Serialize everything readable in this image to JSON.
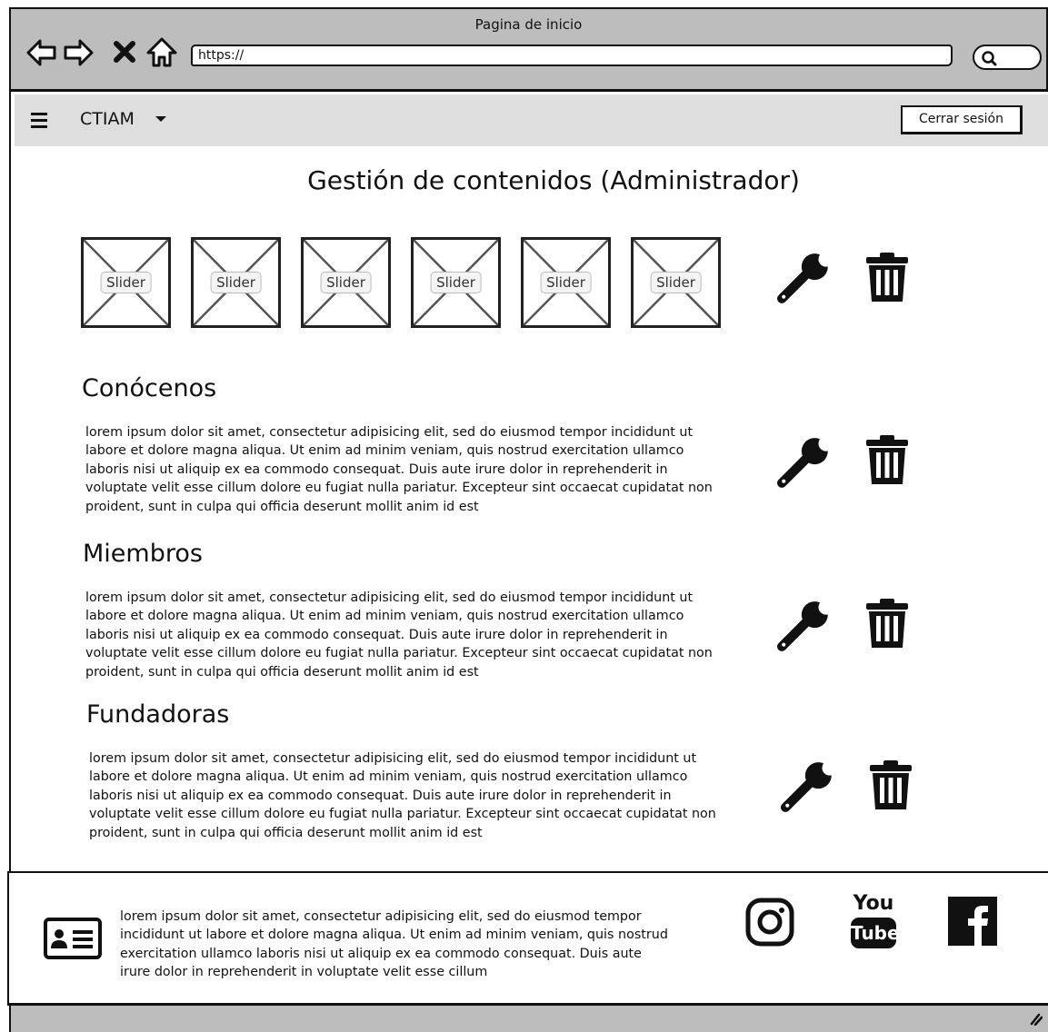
{
  "browser": {
    "window_title": "Pagina de inicio",
    "url": "https://",
    "icons": [
      "back-arrow-icon",
      "forward-arrow-icon",
      "stop-icon",
      "home-icon",
      "search-icon"
    ]
  },
  "navbar": {
    "brand": "CTIAM",
    "logout_label": "Cerrar sesión",
    "icons": [
      "hamburger-menu-icon",
      "caret-down-icon"
    ]
  },
  "page": {
    "title": "Gestión de contenidos (Administrador)"
  },
  "sliders": [
    {
      "label": "Slider"
    },
    {
      "label": "Slider"
    },
    {
      "label": "Slider"
    },
    {
      "label": "Slider"
    },
    {
      "label": "Slider"
    },
    {
      "label": "Slider"
    }
  ],
  "sections": [
    {
      "title": "Conócenos",
      "text": "lorem ipsum dolor sit amet, consectetur adipisicing elit, sed do eiusmod tempor incididunt ut labore et dolore magna aliqua. Ut enim ad minim veniam, quis nostrud exercitation ullamco laboris nisi ut aliquip ex ea commodo consequat. Duis aute irure dolor in reprehenderit in voluptate velit esse cillum dolore eu fugiat nulla pariatur. Excepteur sint occaecat cupidatat non proident, sunt in culpa qui officia deserunt mollit anim id est"
    },
    {
      "title": "Miembros",
      "text": "lorem ipsum dolor sit amet, consectetur adipisicing elit, sed do eiusmod tempor incididunt ut labore et dolore magna aliqua. Ut enim ad minim veniam, quis nostrud exercitation ullamco laboris nisi ut aliquip ex ea commodo consequat. Duis aute irure dolor in reprehenderit in voluptate velit esse cillum dolore eu fugiat nulla pariatur. Excepteur sint occaecat cupidatat non proident, sunt in culpa qui officia deserunt mollit anim id est"
    },
    {
      "title": "Fundadoras",
      "text": "lorem ipsum dolor sit amet, consectetur adipisicing elit, sed do eiusmod tempor incididunt ut labore et dolore magna aliqua. Ut enim ad minim veniam, quis nostrud exercitation ullamco laboris nisi ut aliquip ex ea commodo consequat. Duis aute irure dolor in reprehenderit in voluptate velit esse cillum dolore eu fugiat nulla pariatur. Excepteur sint occaecat cupidatat non proident, sunt in culpa qui officia deserunt mollit anim id est"
    }
  ],
  "actions": {
    "icons": [
      "wrench-icon",
      "trash-icon"
    ]
  },
  "footer": {
    "text": "lorem ipsum dolor sit amet, consectetur adipisicing elit, sed do eiusmod tempor incididunt ut labore et dolore magna aliqua. Ut enim ad minim veniam, quis nostrud exercitation ullamco laboris nisi ut aliquip ex ea commodo consequat. Duis aute irure dolor in reprehenderit in voluptate velit esse cillum",
    "youtube_top": "You",
    "youtube_bottom": "Tube",
    "icons": [
      "contact-card-icon",
      "instagram-icon",
      "youtube-icon",
      "facebook-icon"
    ]
  }
}
